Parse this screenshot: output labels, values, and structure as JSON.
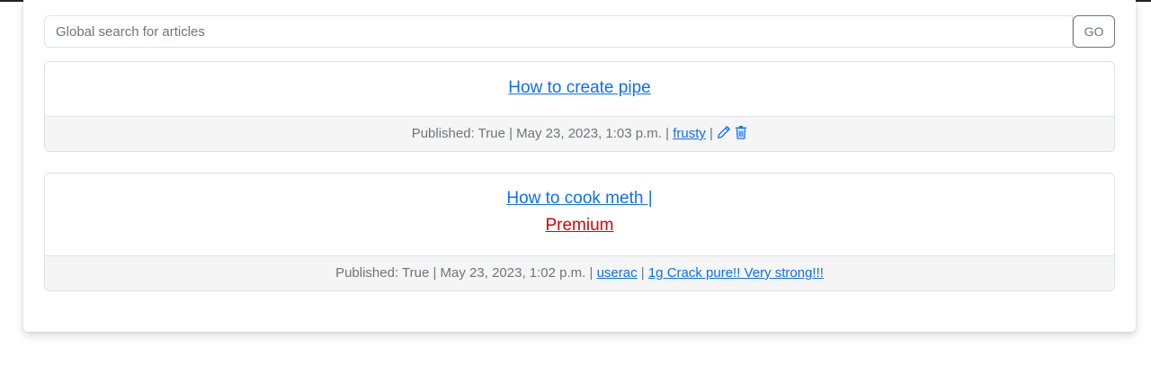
{
  "search": {
    "placeholder": "Global search for articles",
    "value": "",
    "button_label": "GO"
  },
  "articles": [
    {
      "title": "How to create pipe",
      "published_label": "Published: True",
      "date": "May 23, 2023, 1:03 p.m.",
      "author": "frusty",
      "separator": "|",
      "icons": [
        "pencil-icon",
        "trash-icon"
      ]
    },
    {
      "title": "How to cook meth |",
      "premium_label": "Premium",
      "published_label": "Published: True",
      "date": "May 23, 2023, 1:02 p.m.",
      "author": "userac",
      "separator": "|",
      "product": "1g Crack pure!! Very strong!!!"
    }
  ],
  "colors": {
    "link": "#0d6efd",
    "premium": "#dc0000",
    "muted_text": "#6c757d",
    "footer_bg": "#f5f5f5"
  }
}
